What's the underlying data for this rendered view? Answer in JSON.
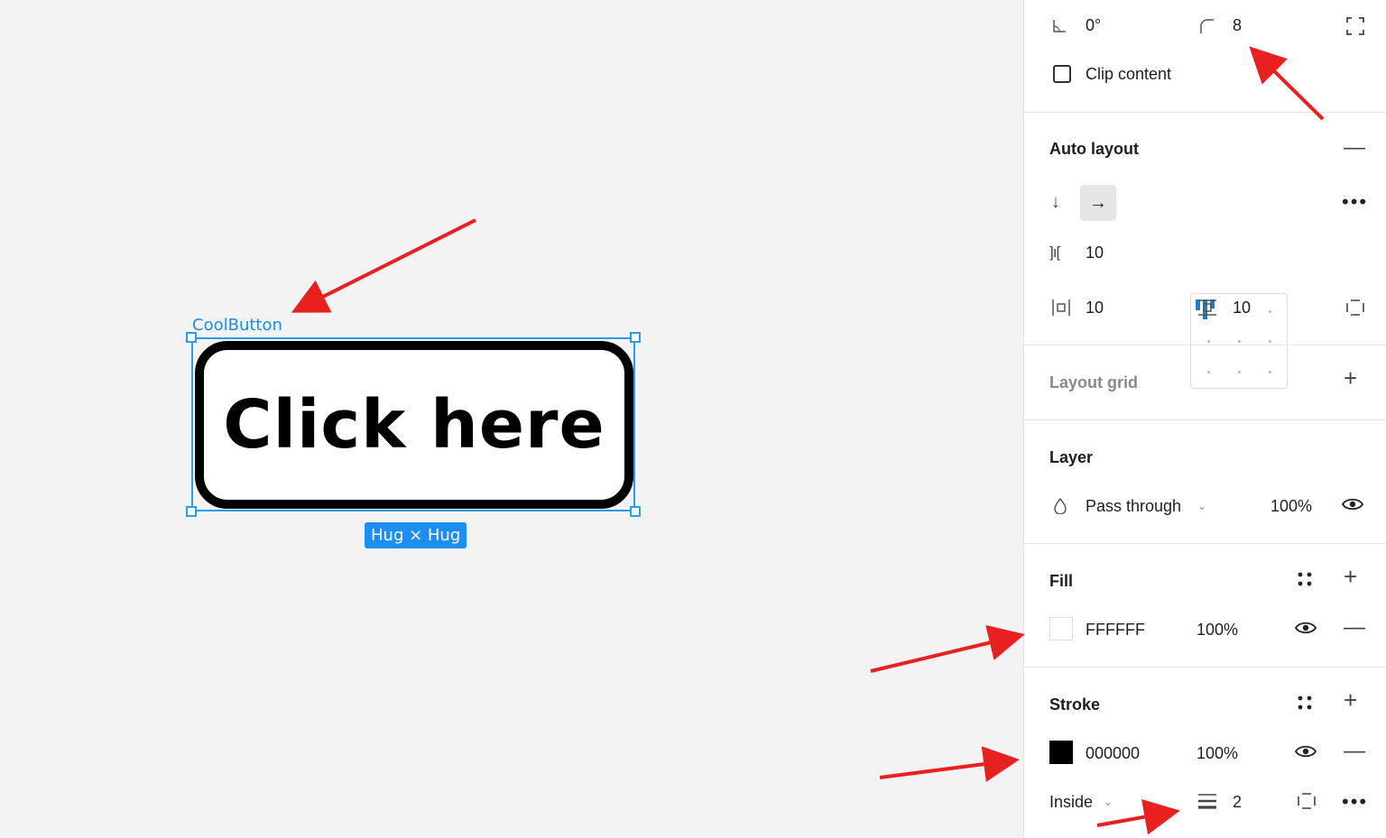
{
  "canvas": {
    "frame_label": "CoolButton",
    "button_text": "Click here",
    "size_badge": "Hug × Hug"
  },
  "panel": {
    "rotation": "0°",
    "corner_radius": "8",
    "clip_content_label": "Clip content",
    "auto_layout": {
      "title": "Auto layout",
      "spacing": "10",
      "padding_horizontal": "10",
      "padding_vertical": "10"
    },
    "layout_grid": {
      "title": "Layout grid"
    },
    "layer": {
      "title": "Layer",
      "blend_mode": "Pass through",
      "opacity": "100%"
    },
    "fill": {
      "title": "Fill",
      "hex": "FFFFFF",
      "opacity": "100%",
      "color": "#FFFFFF"
    },
    "stroke": {
      "title": "Stroke",
      "hex": "000000",
      "opacity": "100%",
      "color": "#000000",
      "position": "Inside",
      "weight": "2"
    }
  },
  "colors": {
    "selection": "#2b9bf0",
    "annotation_arrow": "#e8201f"
  }
}
